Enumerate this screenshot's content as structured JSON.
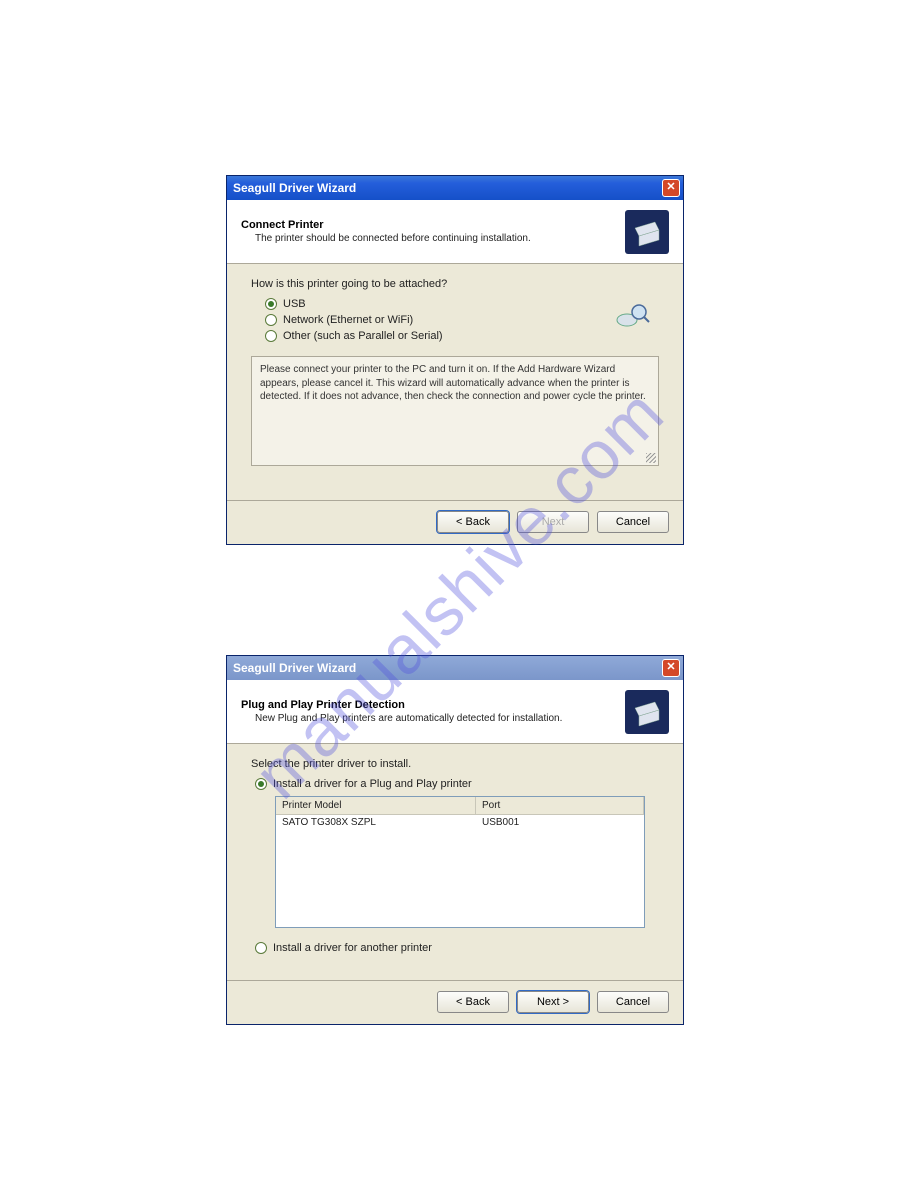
{
  "watermark": "manualshive.com",
  "dialog1": {
    "title": "Seagull Driver Wizard",
    "header_title": "Connect Printer",
    "header_sub": "The printer should be connected before continuing installation.",
    "prompt": "How is this printer going to be attached?",
    "opt_usb": "USB",
    "opt_network": "Network (Ethernet or WiFi)",
    "opt_other": "Other (such as Parallel or Serial)",
    "info": "Please connect your printer to the PC and turn it on. If the Add Hardware Wizard appears, please cancel it. This wizard will automatically advance when the printer is detected. If it does not advance, then check the connection and power cycle the printer.",
    "btn_back": "< Back",
    "btn_next": "Next",
    "btn_cancel": "Cancel"
  },
  "dialog2": {
    "title": "Seagull Driver Wizard",
    "header_title": "Plug and Play Printer Detection",
    "header_sub": "New Plug and Play printers are automatically detected for installation.",
    "prompt": "Select the printer driver to install.",
    "opt_install_pnp": "Install a driver for a Plug and Play printer",
    "col_model": "Printer Model",
    "col_port": "Port",
    "row_model": "SATO TG308X SZPL",
    "row_port": "USB001",
    "opt_install_other": "Install a driver for another printer",
    "btn_back": "< Back",
    "btn_next": "Next >",
    "btn_cancel": "Cancel"
  }
}
